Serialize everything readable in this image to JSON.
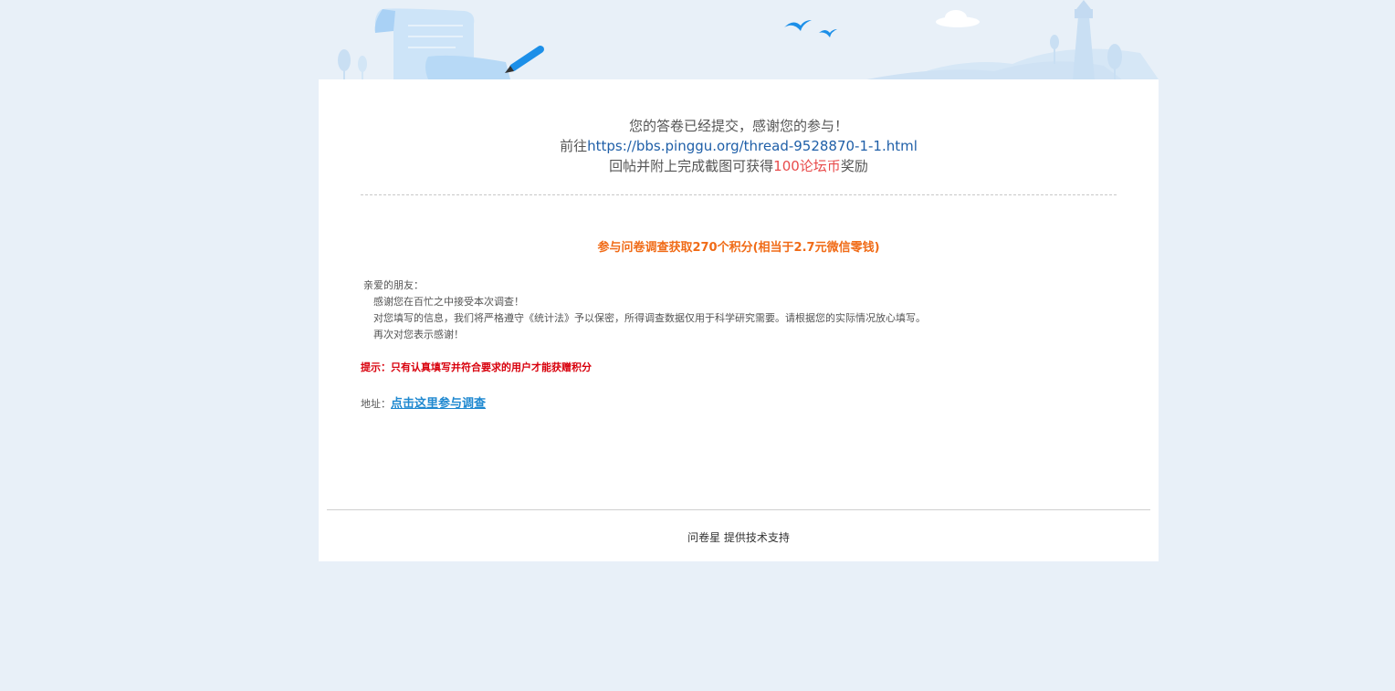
{
  "confirmation": {
    "line1": "您的答卷已经提交，感谢您的参与！",
    "line2_prefix": "前往",
    "thread_link": "https://bbs.pinggu.org/thread-9528870-1-1.html",
    "line3_prefix": "回帖并附上完成截图可获得",
    "reward": "100论坛币",
    "line3_suffix": "奖励"
  },
  "promo": {
    "title": "参与问卷调查获取270个积分(相当于2.7元微信零钱)",
    "greeting": "亲爱的朋友：",
    "para1": "感谢您在百忙之中接受本次调查！",
    "para2": "对您填写的信息，我们将严格遵守《统计法》予以保密，所得调查数据仅用于科学研究需要。请根据您的实际情况放心填写。",
    "para3": "再次对您表示感谢！",
    "tip": "提示：只有认真填写并符合要求的用户才能获赠积分",
    "address_label": "地址：",
    "survey_link": "点击这里参与调查"
  },
  "footer": {
    "brand": "问卷星",
    "support": " 提供技术支持"
  },
  "colors": {
    "page_bg": "#e8f0f8",
    "link_blue": "#1f5fa8",
    "reward_red": "#e84b4b",
    "promo_orange": "#f06b17",
    "tip_red": "#d8000c",
    "survey_link_blue": "#1e88d0"
  },
  "icons": [
    "scroll-document-icon",
    "pen-icon",
    "bird-icon",
    "cloud-icon",
    "lighthouse-icon",
    "tree-icon"
  ]
}
